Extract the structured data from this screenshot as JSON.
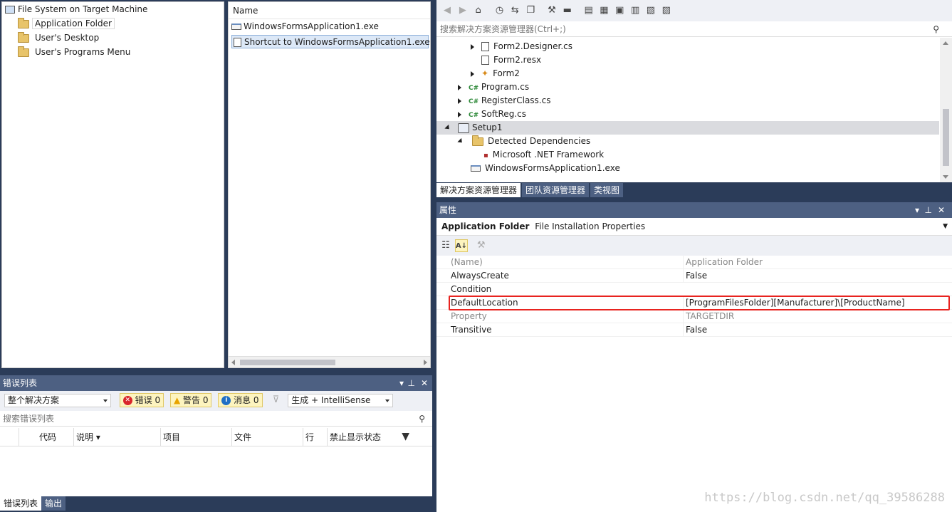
{
  "filesystem": {
    "root_label": "File System on Target Machine",
    "folders": [
      "Application Folder",
      "User's Desktop",
      "User's Programs Menu"
    ]
  },
  "file_list": {
    "column_header": "Name",
    "items": [
      "WindowsFormsApplication1.exe",
      "Shortcut to WindowsFormsApplication1.exe"
    ]
  },
  "solution_explorer": {
    "search_placeholder": "搜索解决方案资源管理器(Ctrl+;)",
    "tree": [
      {
        "label": "Form2.Designer.cs"
      },
      {
        "label": "Form2.resx"
      },
      {
        "label": "Form2"
      },
      {
        "label": "Program.cs"
      },
      {
        "label": "RegisterClass.cs"
      },
      {
        "label": "SoftReg.cs"
      },
      {
        "label": "Setup1"
      },
      {
        "label": "Detected Dependencies"
      },
      {
        "label": "Microsoft .NET Framework"
      },
      {
        "label": "WindowsFormsApplication1.exe"
      }
    ],
    "tabs": [
      "解决方案资源管理器",
      "团队资源管理器",
      "类视图"
    ]
  },
  "properties": {
    "title": "属性",
    "object_name": "Application Folder",
    "object_type": "File Installation Properties",
    "rows": [
      {
        "name": "(Name)",
        "value": "Application Folder"
      },
      {
        "name": "AlwaysCreate",
        "value": "False"
      },
      {
        "name": "Condition",
        "value": ""
      },
      {
        "name": "DefaultLocation",
        "value": "[ProgramFilesFolder][Manufacturer]\\[ProductName]"
      },
      {
        "name": "Property",
        "value": "TARGETDIR"
      },
      {
        "name": "Transitive",
        "value": "False"
      }
    ],
    "highlight_color": "#e8231f"
  },
  "error_list": {
    "title": "错误列表",
    "scope": "整个解决方案",
    "errors_label": "错误 0",
    "warnings_label": "警告 0",
    "messages_label": "消息 0",
    "build_filter": "生成 + IntelliSense",
    "search_placeholder": "搜索错误列表",
    "columns": [
      "代码",
      "说明",
      "项目",
      "文件",
      "行",
      "禁止显示状态"
    ],
    "tabs": [
      "错误列表",
      "输出"
    ]
  },
  "watermark": "https://blog.csdn.net/qq_39586288"
}
